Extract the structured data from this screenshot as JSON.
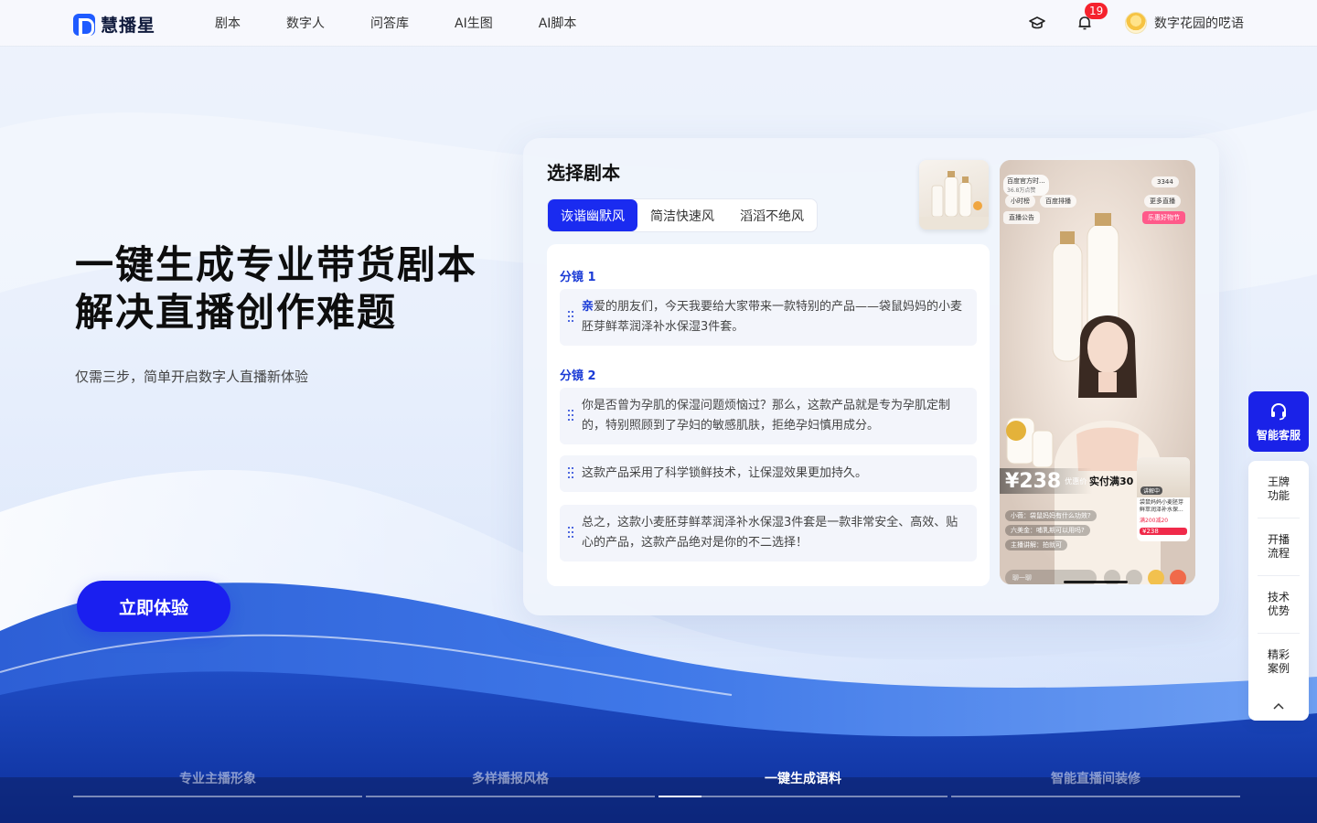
{
  "brand": {
    "name": "慧播星",
    "accent": "#1a22e8"
  },
  "nav": {
    "items": [
      "剧本",
      "数字人",
      "问答库",
      "AI生图",
      "AI脚本"
    ]
  },
  "header": {
    "notification_count": "19",
    "username": "数字花园的呓语"
  },
  "hero": {
    "title_line1": "一键生成专业带货剧本",
    "title_line2": "解决直播创作难题",
    "subtitle": "仅需三步，简单开启数字人直播新体验",
    "cta": "立即体验"
  },
  "card": {
    "title": "选择剧本",
    "tabs": [
      "诙谐幽默风",
      "简洁快速风",
      "滔滔不绝风"
    ],
    "active_tab": 0,
    "segments": [
      {
        "label": "分镜 1",
        "lines": [
          {
            "emph": "亲",
            "text": "爱的朋友们，今天我要给大家带来一款特别的产品——袋鼠妈妈的小麦胚芽鲜萃润泽补水保湿3件套。"
          }
        ]
      },
      {
        "label": "分镜 2",
        "lines": [
          {
            "emph": "",
            "text": "你是否曾为孕肌的保湿问题烦恼过？那么，这款产品就是专为孕肌定制的，特别照顾到了孕妇的敏感肌肤，拒绝孕妇慎用成分。"
          },
          {
            "emph": "",
            "text": "这款产品采用了科学锁鲜技术，让保湿效果更加持久。"
          },
          {
            "emph": "",
            "text": "总之，这款小麦胚芽鲜萃润泽补水保湿3件套是一款非常安全、高效、贴心的产品，这款产品绝对是你的不二选择！"
          }
        ]
      }
    ],
    "phone": {
      "host": "百度官方时...",
      "host_sub": "36.8万点赞",
      "viewer_count": "3344",
      "chip_hour": "小时榜",
      "chip_rank": "百度排播",
      "chip_more": "更多直播",
      "notice": "直播公告",
      "promo": "乐惠好物节",
      "price_symbol": "¥",
      "price": "238",
      "price_note": "优惠价",
      "banner": "实付满30",
      "comments": [
        "小薇：袋鼠妈妈有什么功效?",
        "六美金：哺乳期可以用吗?",
        "主播讲解：拍就可"
      ],
      "input_placeholder": "聊一聊",
      "product_tag": "讲解中",
      "product_name": "袋鼠妈妈小麦胚芽鲜萃润泽补水保...",
      "product_coupon": "满200减20",
      "product_price": "¥238"
    }
  },
  "side": {
    "service": "智能客服",
    "items": [
      "王牌功能",
      "开播流程",
      "技术优势",
      "精彩案例"
    ]
  },
  "bottom_tabs": {
    "items": [
      "专业主播形象",
      "多样播报风格",
      "一键生成语料",
      "智能直播间装修"
    ],
    "active": 2,
    "active_progress": 0.15
  }
}
